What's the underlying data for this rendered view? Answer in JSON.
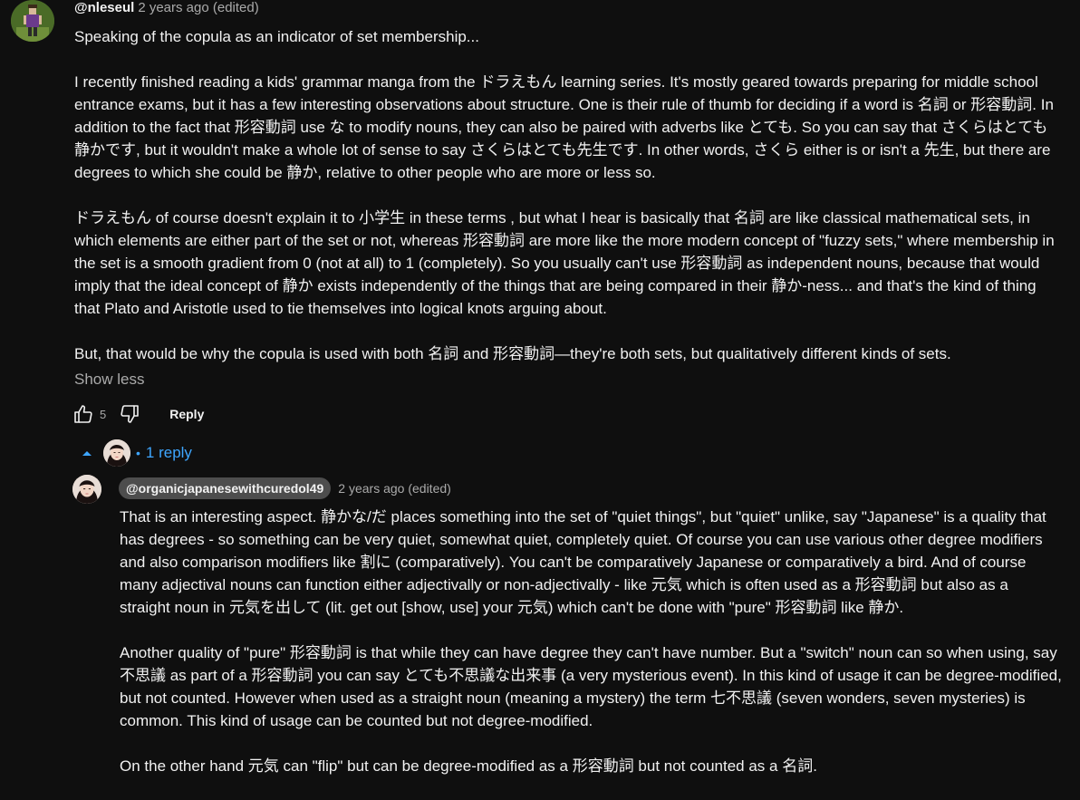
{
  "comment": {
    "author": "@nleseul",
    "meta": "2 years ago (edited)",
    "paragraphs": [
      "Speaking of the copula as an indicator of set membership...",
      "I recently finished reading a kids' grammar manga from the ドラえもん learning series. It's mostly geared towards preparing for middle school entrance exams, but it has a few interesting observations about structure. One is their rule of thumb for deciding if a word is 名詞 or 形容動詞. In addition to the fact that 形容動詞 use な to modify nouns, they can also be paired with adverbs like とても. So you can say that さくらはとても静かです, but it wouldn't make a whole lot of sense to say さくらはとても先生です. In other words, さくら either is or isn't a 先生, but there are degrees to which she could be 静か, relative to other people who are more or less so.",
      "ドラえもん of course doesn't explain it to 小学生 in these terms , but what I hear is basically that 名詞 are like classical mathematical sets, in which elements are either part of the set or not, whereas 形容動詞 are more like the more modern concept of \"fuzzy sets,\" where membership in the set is a smooth gradient from 0 (not at all) to 1 (completely). So you usually can't use 形容動詞 as independent nouns, because that would imply that the ideal concept of 静か exists independently of the things that are being compared in their 静か-ness... and that's the kind of thing that Plato and Aristotle used to tie themselves into logical knots arguing about.",
      "But, that would be why the copula is used with both 名詞 and 形容動詞—they're both sets, but qualitatively different kinds of sets."
    ],
    "show_less": "Show less",
    "like_count": "5",
    "reply_label": "Reply",
    "replies_label": "1 reply"
  },
  "reply": {
    "author": "@organicjapanesewithcuredol49",
    "meta": "2 years ago (edited)",
    "paragraphs": [
      "That is an interesting aspect. 静かな/だ places something into the set of \"quiet things\", but \"quiet\" unlike, say \"Japanese\" is a quality that has degrees - so something can be very quiet, somewhat quiet, completely quiet. Of course you can use various other  degree modifiers and also comparison modifiers like 割に (comparatively). You can't be comparatively Japanese or comparatively a bird. And of course many adjectival nouns can function either adjectivally or non-adjectivally - like 元気 which is often used as a 形容動詞 but also as a straight noun in 元気を出して (lit. get out [show, use] your 元気) which can't be done with \"pure\" 形容動詞 like 静か.",
      "Another quality of \"pure\" 形容動詞 is that while they can have degree they can't have number. But a \"switch\" noun can so when using, say 不思議 as part of a 形容動詞 you can say とても不思議な出来事 (a very mysterious event). In this kind of usage it can be degree-modified, but not counted. However when used as a straight noun (meaning a mystery) the term 七不思議 (seven wonders, seven mysteries) is common. This kind of usage can be counted but not degree-modified.",
      "On the other hand 元気 can \"flip\" but can be degree-modified as a 形容動詞 but not counted as a 名詞."
    ]
  },
  "icons": {
    "like": "thumbs-up-icon",
    "dislike": "thumbs-down-icon",
    "collapse": "caret-up-icon"
  },
  "colors": {
    "background": "#0f0f0f",
    "text": "#f1f1f1",
    "secondary": "#aaaaaa",
    "link": "#3ea6ff",
    "chip": "#4d4d4d"
  }
}
